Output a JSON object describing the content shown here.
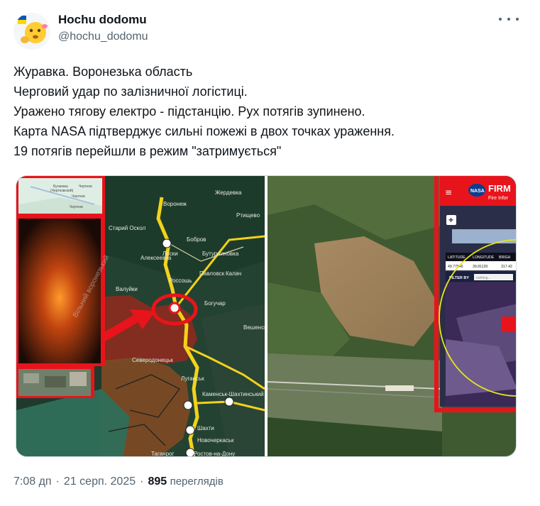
{
  "author": {
    "display_name": "Hochu dodomu",
    "handle": "@hochu_dodomu"
  },
  "tweet_lines": [
    "Журавка.  Воронезька область",
    "Черговий удар по залізничної логістиці.",
    "Уражено тягову електро - підстанцію. Рух потягів зупинено.",
    "Карта NASA підтверджує сильні пожежі в двох точках ураження.",
    "19 потягів перейшли в режим \"затримується\""
  ],
  "media": {
    "inset_map_labels": [
      "Бугаевка",
      "(Чертковский)",
      "Чертков",
      "Чертков",
      "Чертков"
    ],
    "video_watermark": "Вільний воронезький",
    "map_labels": {
      "voronezh": "Воронеж",
      "stary_oskol": "Старий Оскол",
      "liski": "Лиски",
      "bobrov": "Бобров",
      "alekseevka": "Алексеевка",
      "buturlinovka": "Бутурлиновка",
      "pavlovsk": "Павловск",
      "kalach": "Калач",
      "rossosh": "Россошь",
      "valuiki": "Валуйки",
      "boguchar": "Богучар",
      "veshenskaya": "Вешенская",
      "severodonetsk": "Северодонецьк",
      "luhansk": "Луганськ",
      "kamensk": "Каменськ-Шахтинський",
      "shakhty": "Шахти",
      "novocherkassk": "Новочеркаськ",
      "taganrog": "Таганрог",
      "rostov": "Ростов-на-Дону",
      "tambov": "Жердевка",
      "khvorostyanka": "Ртищево"
    },
    "firms": {
      "header_title": "FIRM",
      "header_sub": "Fire Infor",
      "nasa_label": "NASA",
      "plus_button": "+",
      "table_headers": [
        "LATITUDE",
        "LONGITUDE",
        "BRIGH"
      ],
      "table_values": [
        "49.77546",
        "39.81139",
        "317.42"
      ],
      "filter_label": "FILTER BY",
      "filter_placeholder": "nothing..."
    }
  },
  "meta": {
    "time": "7:08 дп",
    "date": "21 серп. 2025",
    "views_count": "895",
    "views_label": "переглядів"
  },
  "colors": {
    "accent_red": "#e8141b",
    "road_yellow": "#f2d21b",
    "text_secondary": "#536471"
  }
}
